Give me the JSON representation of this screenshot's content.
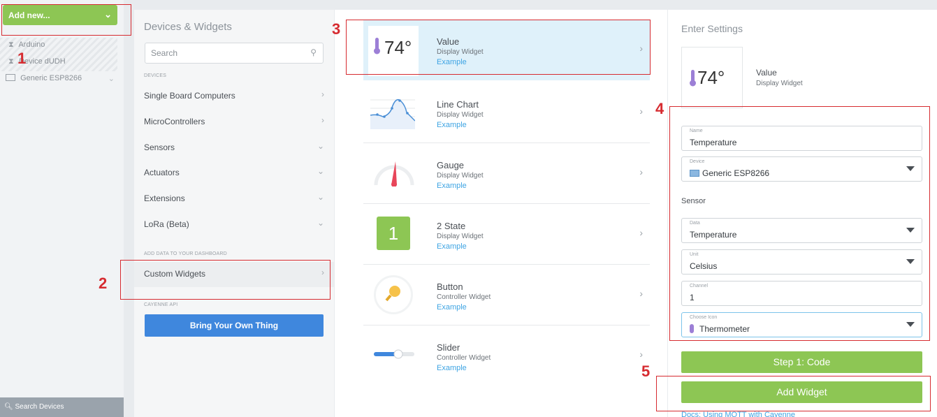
{
  "sidebar": {
    "add_new_label": "Add new...",
    "devices": [
      {
        "name": "Arduino",
        "icon": "hourglass-icon"
      },
      {
        "name": "Device dUDH",
        "icon": "hourglass-icon"
      },
      {
        "name": "Generic ESP8266",
        "icon": "board-icon"
      }
    ],
    "search_devices_label": "Search Devices"
  },
  "catalog": {
    "title": "Devices & Widgets",
    "search_placeholder": "Search",
    "devices_section": "DEVICES",
    "categories": [
      "Single Board Computers",
      "MicroControllers",
      "Sensors",
      "Actuators",
      "Extensions",
      "LoRa (Beta)"
    ],
    "dashboard_section": "ADD DATA TO YOUR DASHBOARD",
    "custom_widgets": "Custom Widgets",
    "api_section": "CAYENNE API",
    "byot_button": "Bring Your Own Thing"
  },
  "widgets": [
    {
      "title": "Value",
      "type": "Display Widget",
      "example": "Example",
      "thumb": "74°"
    },
    {
      "title": "Line Chart",
      "type": "Display Widget",
      "example": "Example"
    },
    {
      "title": "Gauge",
      "type": "Display Widget",
      "example": "Example"
    },
    {
      "title": "2 State",
      "type": "Display Widget",
      "example": "Example",
      "thumb": "1"
    },
    {
      "title": "Button",
      "type": "Controller Widget",
      "example": "Example"
    },
    {
      "title": "Slider",
      "type": "Controller Widget",
      "example": "Example"
    }
  ],
  "settings": {
    "title": "Enter Settings",
    "preview_value": "74°",
    "preview_title": "Value",
    "preview_sub": "Display Widget",
    "name_label": "Name",
    "name_value": "Temperature",
    "device_label": "Device",
    "device_value": "Generic ESP8266",
    "sensor_label": "Sensor",
    "data_label": "Data",
    "data_value": "Temperature",
    "unit_label": "Unit",
    "unit_value": "Celsius",
    "channel_label": "Channel",
    "channel_value": "1",
    "icon_label": "Choose Icon",
    "icon_value": "Thermometer",
    "step1_button": "Step 1: Code",
    "add_widget_button": "Add Widget",
    "docs_link": "Docs: Using MQTT with Cayenne"
  },
  "annotations": [
    "1",
    "2",
    "3",
    "4",
    "5"
  ],
  "colors": {
    "accent_green": "#8dc654",
    "accent_blue": "#3f87dd",
    "annotation_red": "#d62b30",
    "selected_row": "#dff1fa"
  }
}
